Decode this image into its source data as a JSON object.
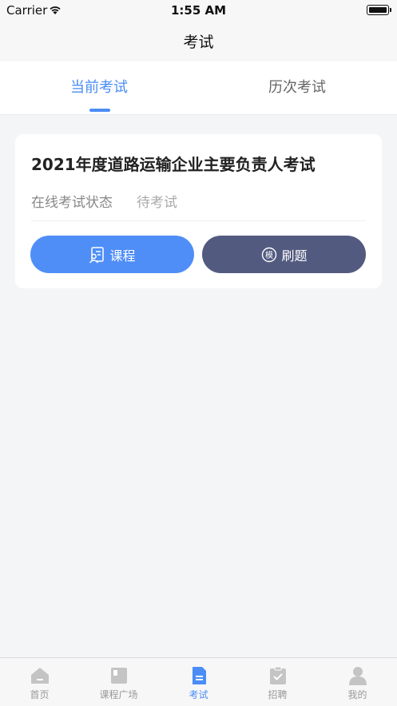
{
  "statusbar": {
    "carrier": "Carrier",
    "time": "1:55 AM"
  },
  "nav": {
    "title": "考试"
  },
  "tabs": [
    {
      "label": "当前考试",
      "active": true
    },
    {
      "label": "历次考试",
      "active": false
    }
  ],
  "exam_card": {
    "title": "2021年度道路运输企业主要负责人考试",
    "status_label": "在线考试状态",
    "status_value": "待考试",
    "course_button": "课程",
    "practice_button": "刷题",
    "practice_icon_text": "模"
  },
  "tabbar": [
    {
      "label": "首页",
      "icon": "home-icon"
    },
    {
      "label": "课程广场",
      "icon": "course-square-icon"
    },
    {
      "label": "考试",
      "icon": "exam-icon",
      "active": true
    },
    {
      "label": "招聘",
      "icon": "recruit-clipboard-icon"
    },
    {
      "label": "我的",
      "icon": "profile-icon"
    }
  ],
  "colors": {
    "accent": "#4a8df6",
    "course_button": "#4f8ef7",
    "practice_button": "#525a80",
    "background": "#f4f5f7",
    "inactive_icon": "#c4c4c4"
  }
}
